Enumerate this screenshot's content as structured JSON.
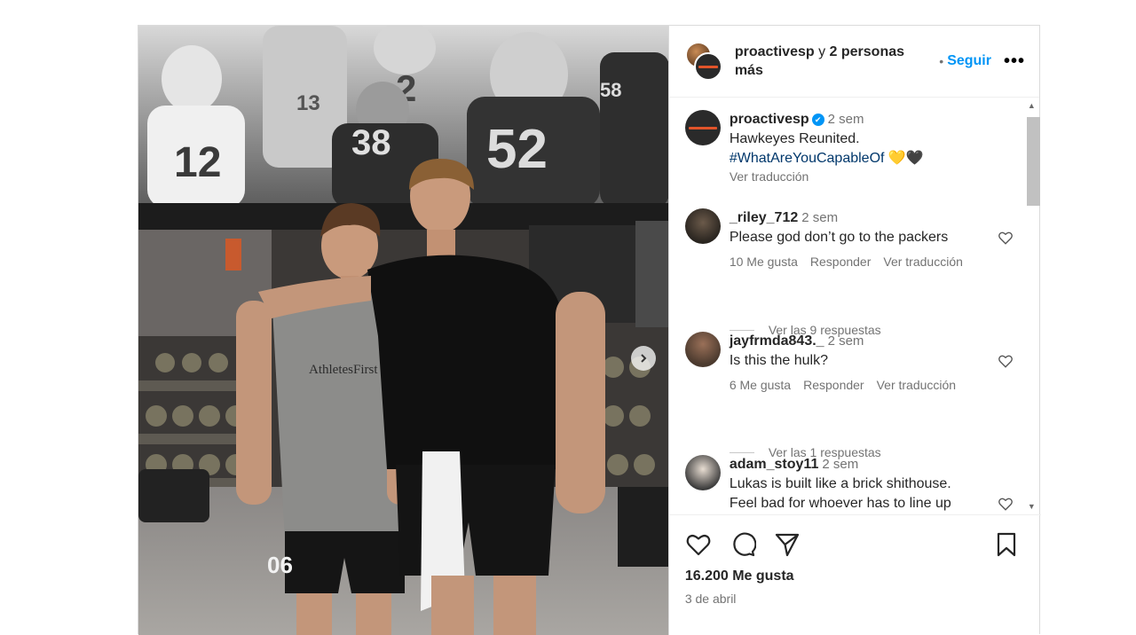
{
  "post": {
    "header": {
      "username": "proactivesp",
      "joiner": " y ",
      "others": "2 personas más",
      "follow_separator": "•",
      "follow_label": "Seguir",
      "more_label": "•••"
    },
    "caption": {
      "username": "proactivesp",
      "verified": "✔",
      "time": "2 sem",
      "line1": "Hawkeyes Reunited.",
      "hashtag": "#WhatAreYouCapableOf",
      "emoji_heart_yellow": "💛",
      "emoji_heart_black": "🖤",
      "translate": "Ver traducción"
    },
    "comments": [
      {
        "username": "_riley_712",
        "time": "2 sem",
        "text": "Please god don’t go to the packers",
        "likes": "10 Me gusta",
        "reply": "Responder",
        "translate": "Ver traducción",
        "replies": "Ver las 9 respuestas"
      },
      {
        "username": "jayfrmda843._",
        "time": "2 sem",
        "text": "Is this the hulk?",
        "likes": "6 Me gusta",
        "reply": "Responder",
        "translate": "Ver traducción",
        "replies": "Ver las 1 respuestas"
      },
      {
        "username": "adam_stoy11",
        "time": "2 sem",
        "text_line1": "Lukas is built like a brick shithouse.",
        "text_line2": "Feel bad for whoever has to line up"
      }
    ],
    "photo": {
      "shirt_text": "AthletesFirst",
      "shorts_number": "06",
      "jersey_numbers": [
        "12",
        "13",
        "2",
        "38",
        "52",
        "58"
      ]
    },
    "actions": {
      "like_icon": "heart-icon",
      "comment_icon": "comment-icon",
      "share_icon": "send-icon",
      "save_icon": "bookmark-icon",
      "likes_count": "16.200 Me gusta",
      "date": "3 de abril"
    }
  }
}
